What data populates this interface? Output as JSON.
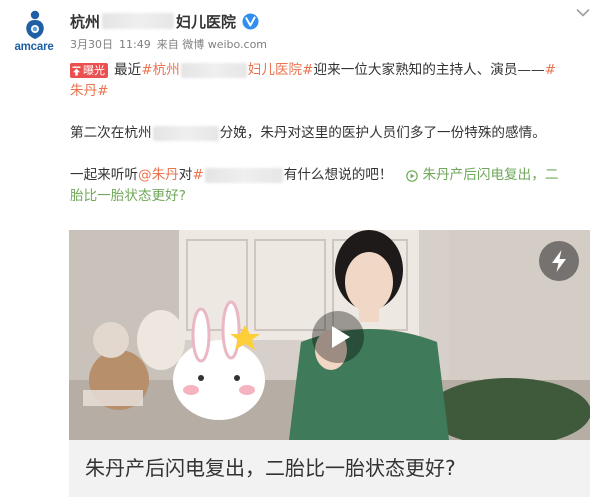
{
  "avatar": {
    "brand_text": "amcare",
    "icon": "amcare-logo"
  },
  "header": {
    "name_prefix": "杭州",
    "name_suffix": "妇儿医院",
    "verified_icon": "verified-icon",
    "date": "3月30日",
    "time": "11:49",
    "source": "来自 微博 weibo.com",
    "menu_icon": "chevron-down-icon"
  },
  "post": {
    "badge": "曝光",
    "l1_lead": "最近",
    "l1_tag_a": "#杭州",
    "l1_tag_b": "妇儿医院#",
    "l1_text": " 迎来一位大家熟知的主持人、演员——",
    "l1_hash": "#",
    "l2_tag": "朱丹#",
    "l3_a": "第二次在杭州",
    "l3_b": "分娩，朱丹对这里的医护人员们多了一份特殊的感情。",
    "l4_a": "一起来听听",
    "l4_mention": "@朱丹",
    "l4_b": " 对",
    "l4_hash": "#",
    "l4_c": "有什么想说的吧！",
    "l4_link": "朱丹产后闪电复出，二",
    "l5_link": "胎比一胎状态更好?"
  },
  "video": {
    "caption": "朱丹产后闪电复出，二胎比一胎状态更好?",
    "play_icon": "play-icon",
    "flash_icon": "lightning-icon"
  }
}
